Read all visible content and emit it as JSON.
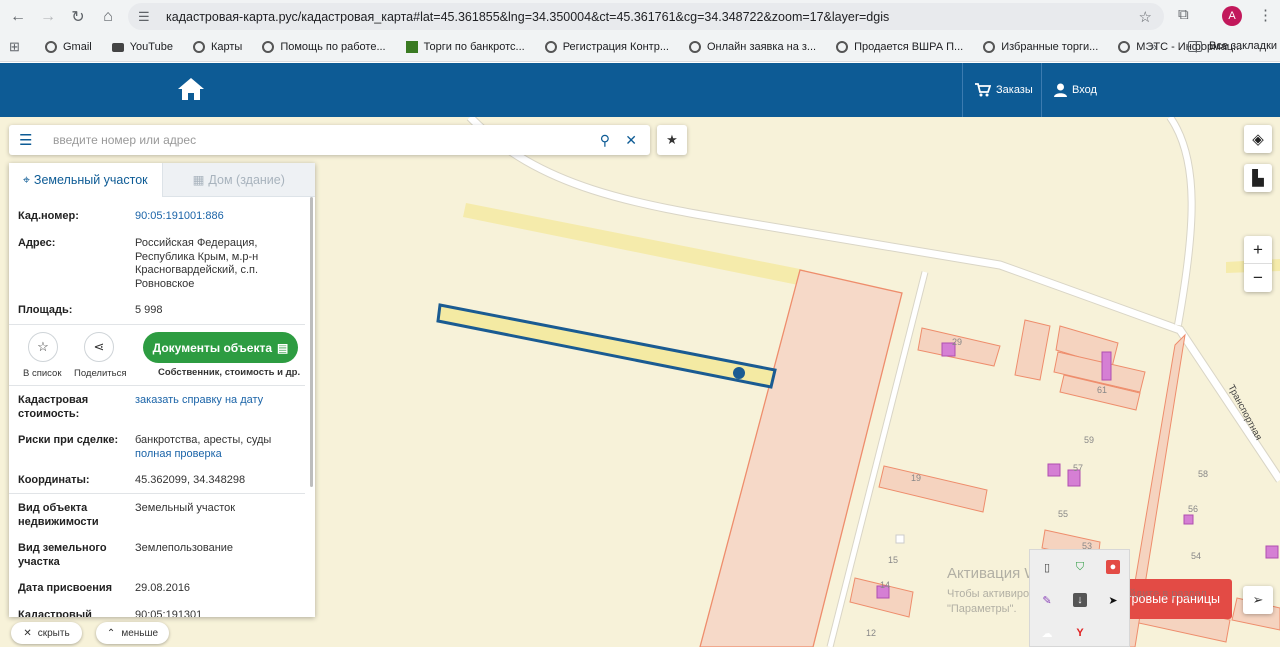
{
  "browser": {
    "url": "кадастровая-карта.рус/кадастровая_карта#lat=45.361855&lng=34.350004&ct=45.361761&cg=34.348722&zoom=17&layer=dgis",
    "avatar_letter": "A",
    "bookmarks": [
      "Gmail",
      "YouTube",
      "Карты",
      "Помощь по работе...",
      "Торги по банкротс...",
      "Регистрация Контр...",
      "Онлайн заявка на з...",
      "Продается ВШРА П...",
      "Избранные торги...",
      "МЭТС - Информац..."
    ],
    "all_bookmarks": "Все закладки"
  },
  "header": {
    "orders": "Заказы",
    "login": "Вход"
  },
  "search": {
    "placeholder": "введите номер или адрес"
  },
  "panel": {
    "tab_land": "Земельный участок",
    "tab_house": "Дом (здание)",
    "cad_label": "Кад.номер:",
    "cad_value": "90:05:191001:886",
    "addr_label": "Адрес:",
    "addr_value": "Российская Федерация, Республика Крым, м.р-н Красногвардейский, с.п. Ровновское",
    "area_label": "Площадь:",
    "area_value": "5 998",
    "to_list": "В список",
    "share": "Поделиться",
    "docs_button": "Документы объекта",
    "docs_sub": "Собственник, стоимость и др.",
    "cost_label": "Кадастровая стоимость:",
    "cost_link": "заказать справку на дату",
    "risk_label": "Риски при сделке:",
    "risk_value": "банкротства, аресты, суды",
    "risk_link": "полная проверка",
    "coord_label": "Координаты:",
    "coord_value": "45.362099, 34.348298",
    "type_label": "Вид объекта недвижимости",
    "type_value": "Земельный участок",
    "land_label": "Вид земельного участка",
    "land_value": "Землепользование",
    "date_label": "Дата присвоения",
    "date_value": "29.08.2016",
    "last_label": "Кадастровый",
    "last_value": "90:05:191301"
  },
  "bottom": {
    "hide": "скрыть",
    "less": "меньше"
  },
  "map": {
    "street": "Транспортная",
    "numbers": [
      "29",
      "61",
      "59",
      "57",
      "19",
      "55",
      "58",
      "56",
      "53",
      "15",
      "54",
      "14",
      "12"
    ]
  },
  "boundaries_button": "стровые границы",
  "watermark": {
    "title": "Активация Windows",
    "text": "Чтобы активировать Windows, перейдите в раздел \"Параметры\"."
  },
  "colors": {
    "header": "#0d5b95",
    "docs_green": "#2d9c41",
    "boundaries_red": "#e34b45",
    "parcel_outline": "#1a5b92",
    "parcel_fill": "#f4eaa3",
    "map_bg": "#f7f2d9",
    "plot_stroke": "#ee8d6c",
    "plot_fill": "#f5d3bf"
  }
}
